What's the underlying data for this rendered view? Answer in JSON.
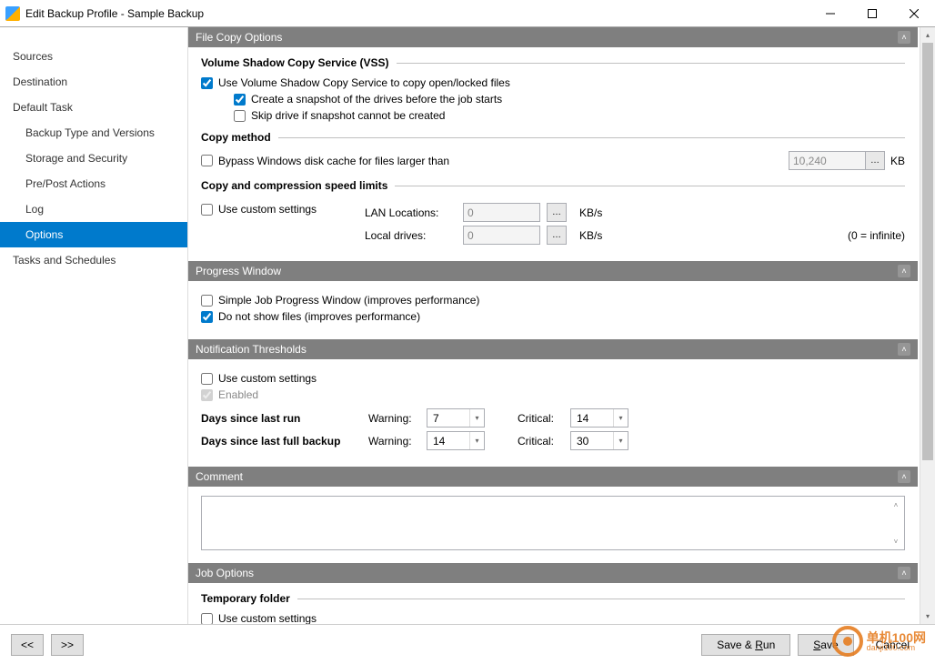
{
  "window": {
    "title": "Edit Backup Profile - Sample Backup"
  },
  "sidebar": {
    "items": [
      {
        "label": "Sources",
        "sub": false,
        "selected": false
      },
      {
        "label": "Destination",
        "sub": false,
        "selected": false
      },
      {
        "label": "Default Task",
        "sub": false,
        "selected": false
      },
      {
        "label": "Backup Type and Versions",
        "sub": true,
        "selected": false
      },
      {
        "label": "Storage and Security",
        "sub": true,
        "selected": false
      },
      {
        "label": "Pre/Post Actions",
        "sub": true,
        "selected": false
      },
      {
        "label": "Log",
        "sub": true,
        "selected": false
      },
      {
        "label": "Options",
        "sub": true,
        "selected": true
      },
      {
        "label": "Tasks and Schedules",
        "sub": false,
        "selected": false
      }
    ]
  },
  "sections": {
    "file_copy": {
      "title": "File Copy Options",
      "vss_group": "Volume Shadow Copy Service (VSS)",
      "use_vss": "Use Volume Shadow Copy Service to copy open/locked files",
      "create_snapshot": "Create a snapshot of the drives before the job starts",
      "skip_drive": "Skip drive if snapshot cannot be created",
      "copy_method_group": "Copy method",
      "bypass_cache": "Bypass Windows disk cache for files larger than",
      "bypass_value": "10,240",
      "bypass_unit": "KB",
      "speed_group": "Copy and compression speed limits",
      "use_custom": "Use custom settings",
      "lan_label": "LAN Locations:",
      "lan_value": "0",
      "local_label": "Local drives:",
      "local_value": "0",
      "kbs": "KB/s",
      "infinite_hint": "(0 = infinite)"
    },
    "progress": {
      "title": "Progress Window",
      "simple": "Simple Job Progress Window (improves performance)",
      "no_files": "Do not show files (improves performance)"
    },
    "notif": {
      "title": "Notification Thresholds",
      "use_custom": "Use custom settings",
      "enabled": "Enabled",
      "days_run": "Days since last run",
      "days_full": "Days since last full backup",
      "warning": "Warning:",
      "critical": "Critical:",
      "run_warn": "7",
      "run_crit": "14",
      "full_warn": "14",
      "full_crit": "30"
    },
    "comment": {
      "title": "Comment"
    },
    "job": {
      "title": "Job Options",
      "temp_group": "Temporary folder",
      "use_custom": "Use custom settings"
    }
  },
  "footer": {
    "prev": "<<",
    "next": ">>",
    "save_run": "Save & Run",
    "save": "Save",
    "cancel": "Cancel"
  },
  "watermark": {
    "line1": "单机100网",
    "line2": "danji100.com"
  }
}
